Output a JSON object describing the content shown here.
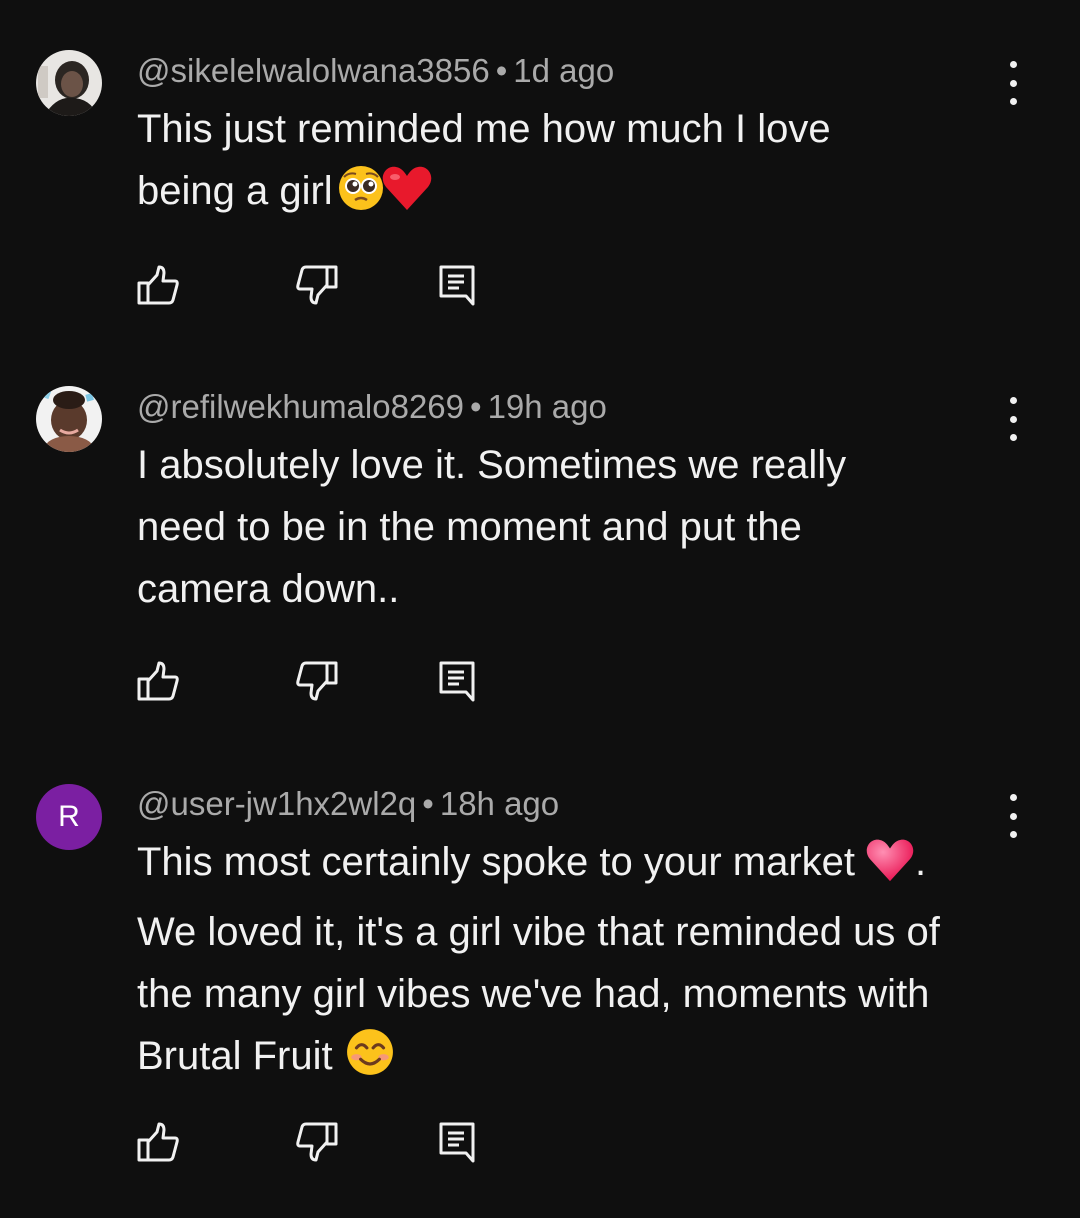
{
  "comments": [
    {
      "username": "@sikelelwalolwana3856",
      "separator": "•",
      "time": "1d ago",
      "lines": [
        "This just reminded me how much I love",
        "being a girl"
      ],
      "emojis": [
        "pleading-face-emoji",
        "red-heart-emoji"
      ]
    },
    {
      "username": "@refilwekhumalo8269",
      "separator": "•",
      "time": "19h ago",
      "lines": [
        "I absolutely love it. Sometimes we really",
        "need to be in the moment and put the",
        "camera down.."
      ]
    },
    {
      "avatar_letter": "R",
      "avatar_color": "#7b1fa2",
      "username": "@user-jw1hx2wl2q",
      "separator": "•",
      "time": "18h ago",
      "lines": [
        "This most certainly spoke to your market",
        ".",
        "We loved it, it's a girl vibe that reminded us of",
        "the many girl vibes we've had, moments with",
        "Brutal Fruit"
      ],
      "emojis": [
        "pink-heart-emoji",
        "smiling-face-emoji"
      ]
    }
  ],
  "icons": {
    "like": "thumbs-up-icon",
    "dislike": "thumbs-down-icon",
    "reply": "reply-icon",
    "more": "more-vertical-icon"
  },
  "colors": {
    "background": "#0f0f0f",
    "text": "#f1f1f1",
    "meta": "#aaaaaa"
  }
}
